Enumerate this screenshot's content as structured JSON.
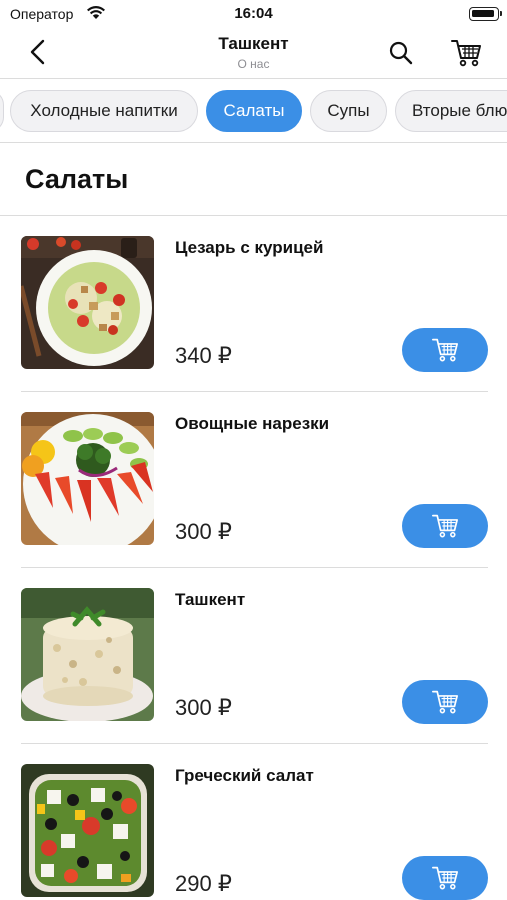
{
  "status_bar": {
    "carrier": "Оператор",
    "time": "16:04"
  },
  "nav": {
    "title": "Ташкент",
    "subtitle": "О нас",
    "icons": [
      "chevron-left-icon",
      "search-icon",
      "cart-icon"
    ]
  },
  "categories": [
    {
      "label": "Холодные напитки",
      "active": false
    },
    {
      "label": "Салаты",
      "active": true
    },
    {
      "label": "Супы",
      "active": false
    },
    {
      "label": "Вторые блю",
      "active": false
    }
  ],
  "section_title": "Салаты",
  "items": [
    {
      "name": "Цезарь с курицей",
      "price": "340 ₽"
    },
    {
      "name": "Овощные нарезки",
      "price": "300 ₽"
    },
    {
      "name": "Ташкент",
      "price": "300 ₽"
    },
    {
      "name": "Греческий салат",
      "price": "290 ₽"
    }
  ],
  "colors": {
    "accent": "#3b8fe6",
    "chip_bg": "#f2f2f4",
    "divider": "#dcdcdc"
  }
}
